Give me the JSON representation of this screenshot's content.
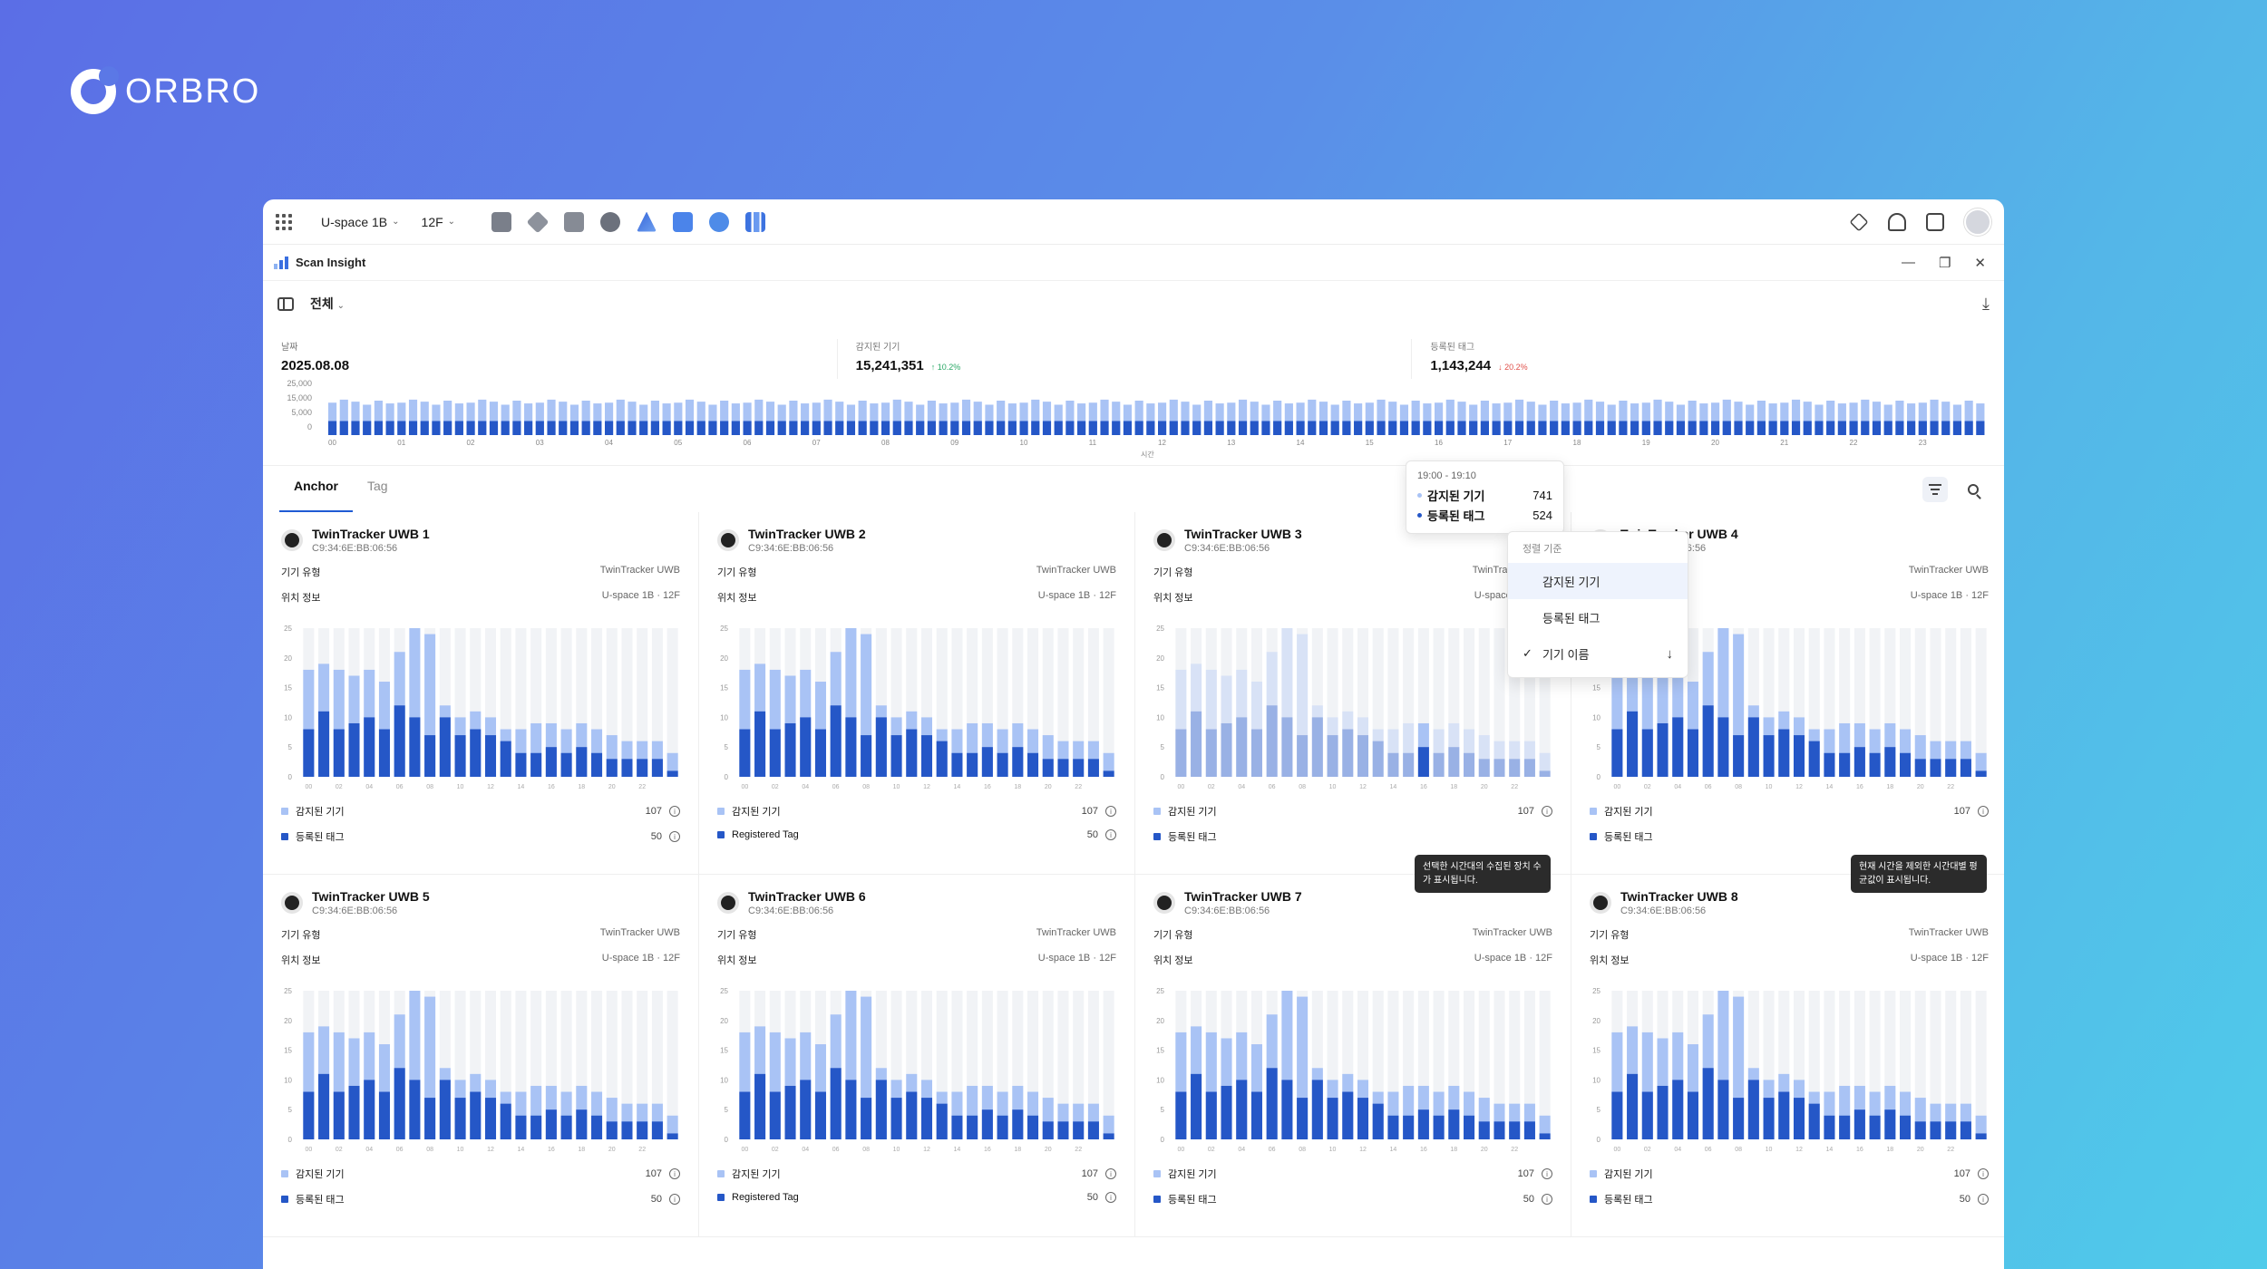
{
  "brand": {
    "logo_text": "ORBRO"
  },
  "topbar": {
    "space": "U-space 1B",
    "floor": "12F"
  },
  "app": {
    "title": "Scan Insight"
  },
  "filter": {
    "scope": "전체"
  },
  "stats": [
    {
      "label": "날짜",
      "value": "2025.08.08",
      "trend": "",
      "dir": ""
    },
    {
      "label": "감지된 기기",
      "value": "15,241,351",
      "trend": "↑ 10.2%",
      "dir": "up"
    },
    {
      "label": "등록된 태그",
      "value": "1,143,244",
      "trend": "↓ 20.2%",
      "dir": "down"
    }
  ],
  "timeline": {
    "y_ticks": [
      "25,000",
      "15,000",
      "5,000",
      "0"
    ],
    "x_ticks": [
      "00",
      "01",
      "02",
      "03",
      "04",
      "05",
      "06",
      "07",
      "08",
      "09",
      "10",
      "11",
      "12",
      "13",
      "14",
      "15",
      "16",
      "17",
      "18",
      "19",
      "20",
      "21",
      "22",
      "23"
    ],
    "x_title": "시간"
  },
  "hover_tooltip": {
    "time": "19:00 - 19:10",
    "rows": [
      {
        "label": "감지된 기기",
        "value": "741"
      },
      {
        "label": "등록된 태그",
        "value": "524"
      }
    ]
  },
  "tabs": [
    "Anchor",
    "Tag"
  ],
  "sort_menu": {
    "header": "정렬 기준",
    "items": [
      "감지된 기기",
      "등록된 태그",
      "기기 이름"
    ]
  },
  "card_labels": {
    "type": "기기 유형",
    "location": "위치 정보"
  },
  "cards": [
    {
      "name": "TwinTracker UWB 1",
      "mac": "C9:34:6E:BB:06:56",
      "type": "TwinTracker UWB",
      "loc": "U-space 1B · 12F",
      "leg1": "감지된 기기",
      "v1": "107",
      "leg2": "등록된 태그",
      "v2": "50"
    },
    {
      "name": "TwinTracker UWB 2",
      "mac": "C9:34:6E:BB:06:56",
      "type": "TwinTracker UWB",
      "loc": "U-space 1B · 12F",
      "leg1": "감지된 기기",
      "v1": "107",
      "leg2": "Registered Tag",
      "v2": "50"
    },
    {
      "name": "TwinTracker UWB 3",
      "mac": "C9:34:6E:BB:06:56",
      "type": "TwinTracker UWB",
      "loc": "U-space 1B · 12F",
      "leg1": "감지된 기기",
      "v1": "107",
      "leg2": "등록된 태그",
      "v2": ""
    },
    {
      "name": "TwinTracker UWB 4",
      "mac": "C9:34:6E:BB:06:56",
      "type": "TwinTracker UWB",
      "loc": "U-space 1B · 12F",
      "leg1": "감지된 기기",
      "v1": "107",
      "leg2": "등록된 태그",
      "v2": ""
    },
    {
      "name": "TwinTracker UWB 5",
      "mac": "C9:34:6E:BB:06:56",
      "type": "TwinTracker UWB",
      "loc": "U-space 1B · 12F",
      "leg1": "감지된 기기",
      "v1": "107",
      "leg2": "등록된 태그",
      "v2": "50"
    },
    {
      "name": "TwinTracker UWB 6",
      "mac": "C9:34:6E:BB:06:56",
      "type": "TwinTracker UWB",
      "loc": "U-space 1B · 12F",
      "leg1": "감지된 기기",
      "v1": "107",
      "leg2": "Registered Tag",
      "v2": "50"
    },
    {
      "name": "TwinTracker UWB 7",
      "mac": "C9:34:6E:BB:06:56",
      "type": "TwinTracker UWB",
      "loc": "U-space 1B · 12F",
      "leg1": "감지된 기기",
      "v1": "107",
      "leg2": "등록된 태그",
      "v2": "50"
    },
    {
      "name": "TwinTracker UWB 8",
      "mac": "C9:34:6E:BB:06:56",
      "type": "TwinTracker UWB",
      "loc": "U-space 1B · 12F",
      "leg1": "감지된 기기",
      "v1": "107",
      "leg2": "등록된 태그",
      "v2": "50"
    }
  ],
  "tips": {
    "card3": "선택한 시간대의 수집된 장치 수가 표시됩니다.",
    "card4": "현재 시간을 제외한 시간대별 평균값이 표시됩니다."
  },
  "chart_data": {
    "type": "bar",
    "title": "",
    "y_ticks": [
      "25",
      "20",
      "15",
      "10",
      "5",
      "0"
    ],
    "x_ticks": [
      "00",
      "02",
      "04",
      "06",
      "08",
      "10",
      "12",
      "14",
      "16",
      "18",
      "20",
      "22"
    ],
    "ylim": [
      0,
      25
    ],
    "series": [
      {
        "name": "감지된 기기",
        "values": [
          18,
          19,
          18,
          17,
          18,
          16,
          21,
          25,
          24,
          12,
          10,
          11,
          10,
          8,
          8,
          9,
          9,
          8,
          9,
          8,
          7,
          6,
          6,
          6,
          4
        ]
      },
      {
        "name": "등록된 태그",
        "values": [
          8,
          11,
          8,
          9,
          10,
          8,
          12,
          10,
          7,
          10,
          7,
          8,
          7,
          6,
          4,
          4,
          5,
          4,
          5,
          4,
          3,
          3,
          3,
          3,
          1
        ]
      }
    ],
    "colors": {
      "detected": "#a9c3f5",
      "registered": "#2557c7",
      "empty": "#f1f3f6"
    }
  },
  "colors": {
    "accent": "#1f5bd4",
    "light": "#a9c3f5",
    "dark": "#2557c7"
  }
}
